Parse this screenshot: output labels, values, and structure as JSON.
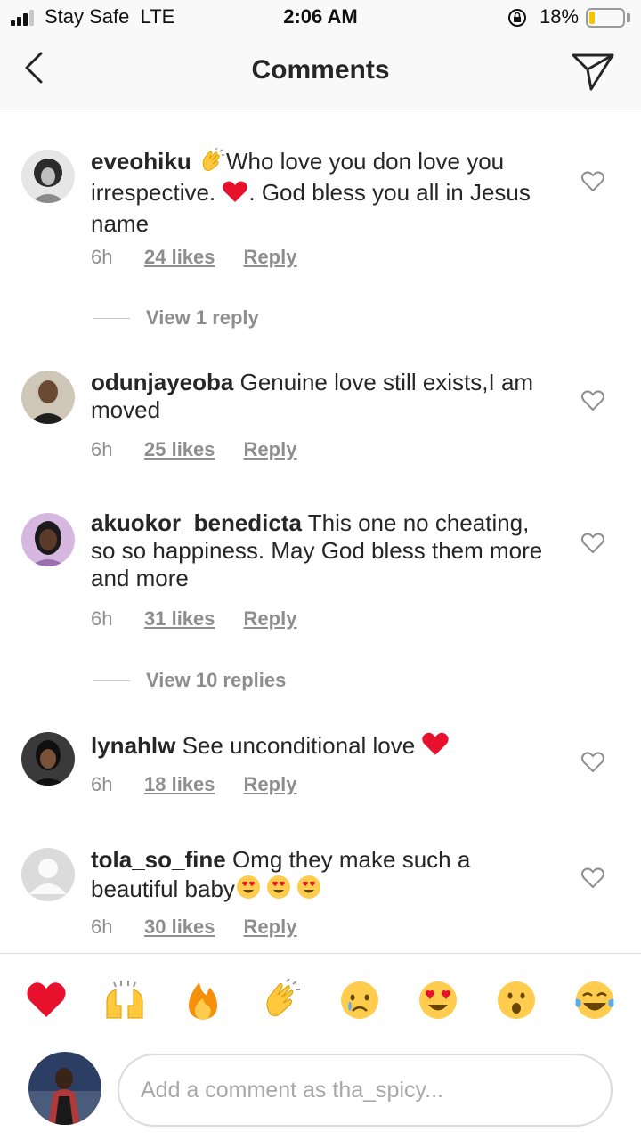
{
  "status_bar": {
    "carrier": "Stay Safe  LTE",
    "time": "2:06 AM",
    "battery_percent": "18%",
    "battery_level": 0.18,
    "lock_icon": "orientation-lock-icon",
    "battery_color": "#f5c400"
  },
  "header": {
    "title": "Comments",
    "back_icon": "chevron-left-icon",
    "send_icon": "paper-plane-icon"
  },
  "comments": [
    {
      "username": "eveohiku",
      "text_parts": [
        "👏",
        "Who love you don love you irrespective. ",
        "❤️",
        ". God bless you all in Jesus name"
      ],
      "time": "6h",
      "likes": "24 likes",
      "reply_label": "Reply",
      "view_replies": "View 1 reply"
    },
    {
      "username": "odunjayeoba",
      "text": "Genuine love still exists,I am moved",
      "time": "6h",
      "likes": "25 likes",
      "reply_label": "Reply"
    },
    {
      "username": "akuokor_benedicta",
      "text": "This one no cheating, so so happiness. May God bless them more and more",
      "time": "6h",
      "likes": "31 likes",
      "reply_label": "Reply",
      "view_replies": "View 10 replies"
    },
    {
      "username": "lynahlw",
      "text": "See unconditional love ",
      "emoji": "❤️",
      "time": "6h",
      "likes": "18 likes",
      "reply_label": "Reply"
    },
    {
      "username": "tola_so_fine",
      "text": "Omg they make such a beautiful baby",
      "emoji": "😍😍😍",
      "time": "6h",
      "likes": "30 likes",
      "reply_label": "Reply"
    }
  ],
  "reactions": [
    "heart",
    "raised-hands",
    "fire",
    "clapping-hands",
    "crying-face",
    "heart-eyes",
    "surprised-face",
    "tears-of-joy"
  ],
  "composer": {
    "placeholder": "Add a comment as tha_spicy..."
  },
  "colors": {
    "text": "#262626",
    "secondary": "#8e8e8e",
    "divider": "#dbdbdb",
    "heart_red": "#ed1c24"
  }
}
